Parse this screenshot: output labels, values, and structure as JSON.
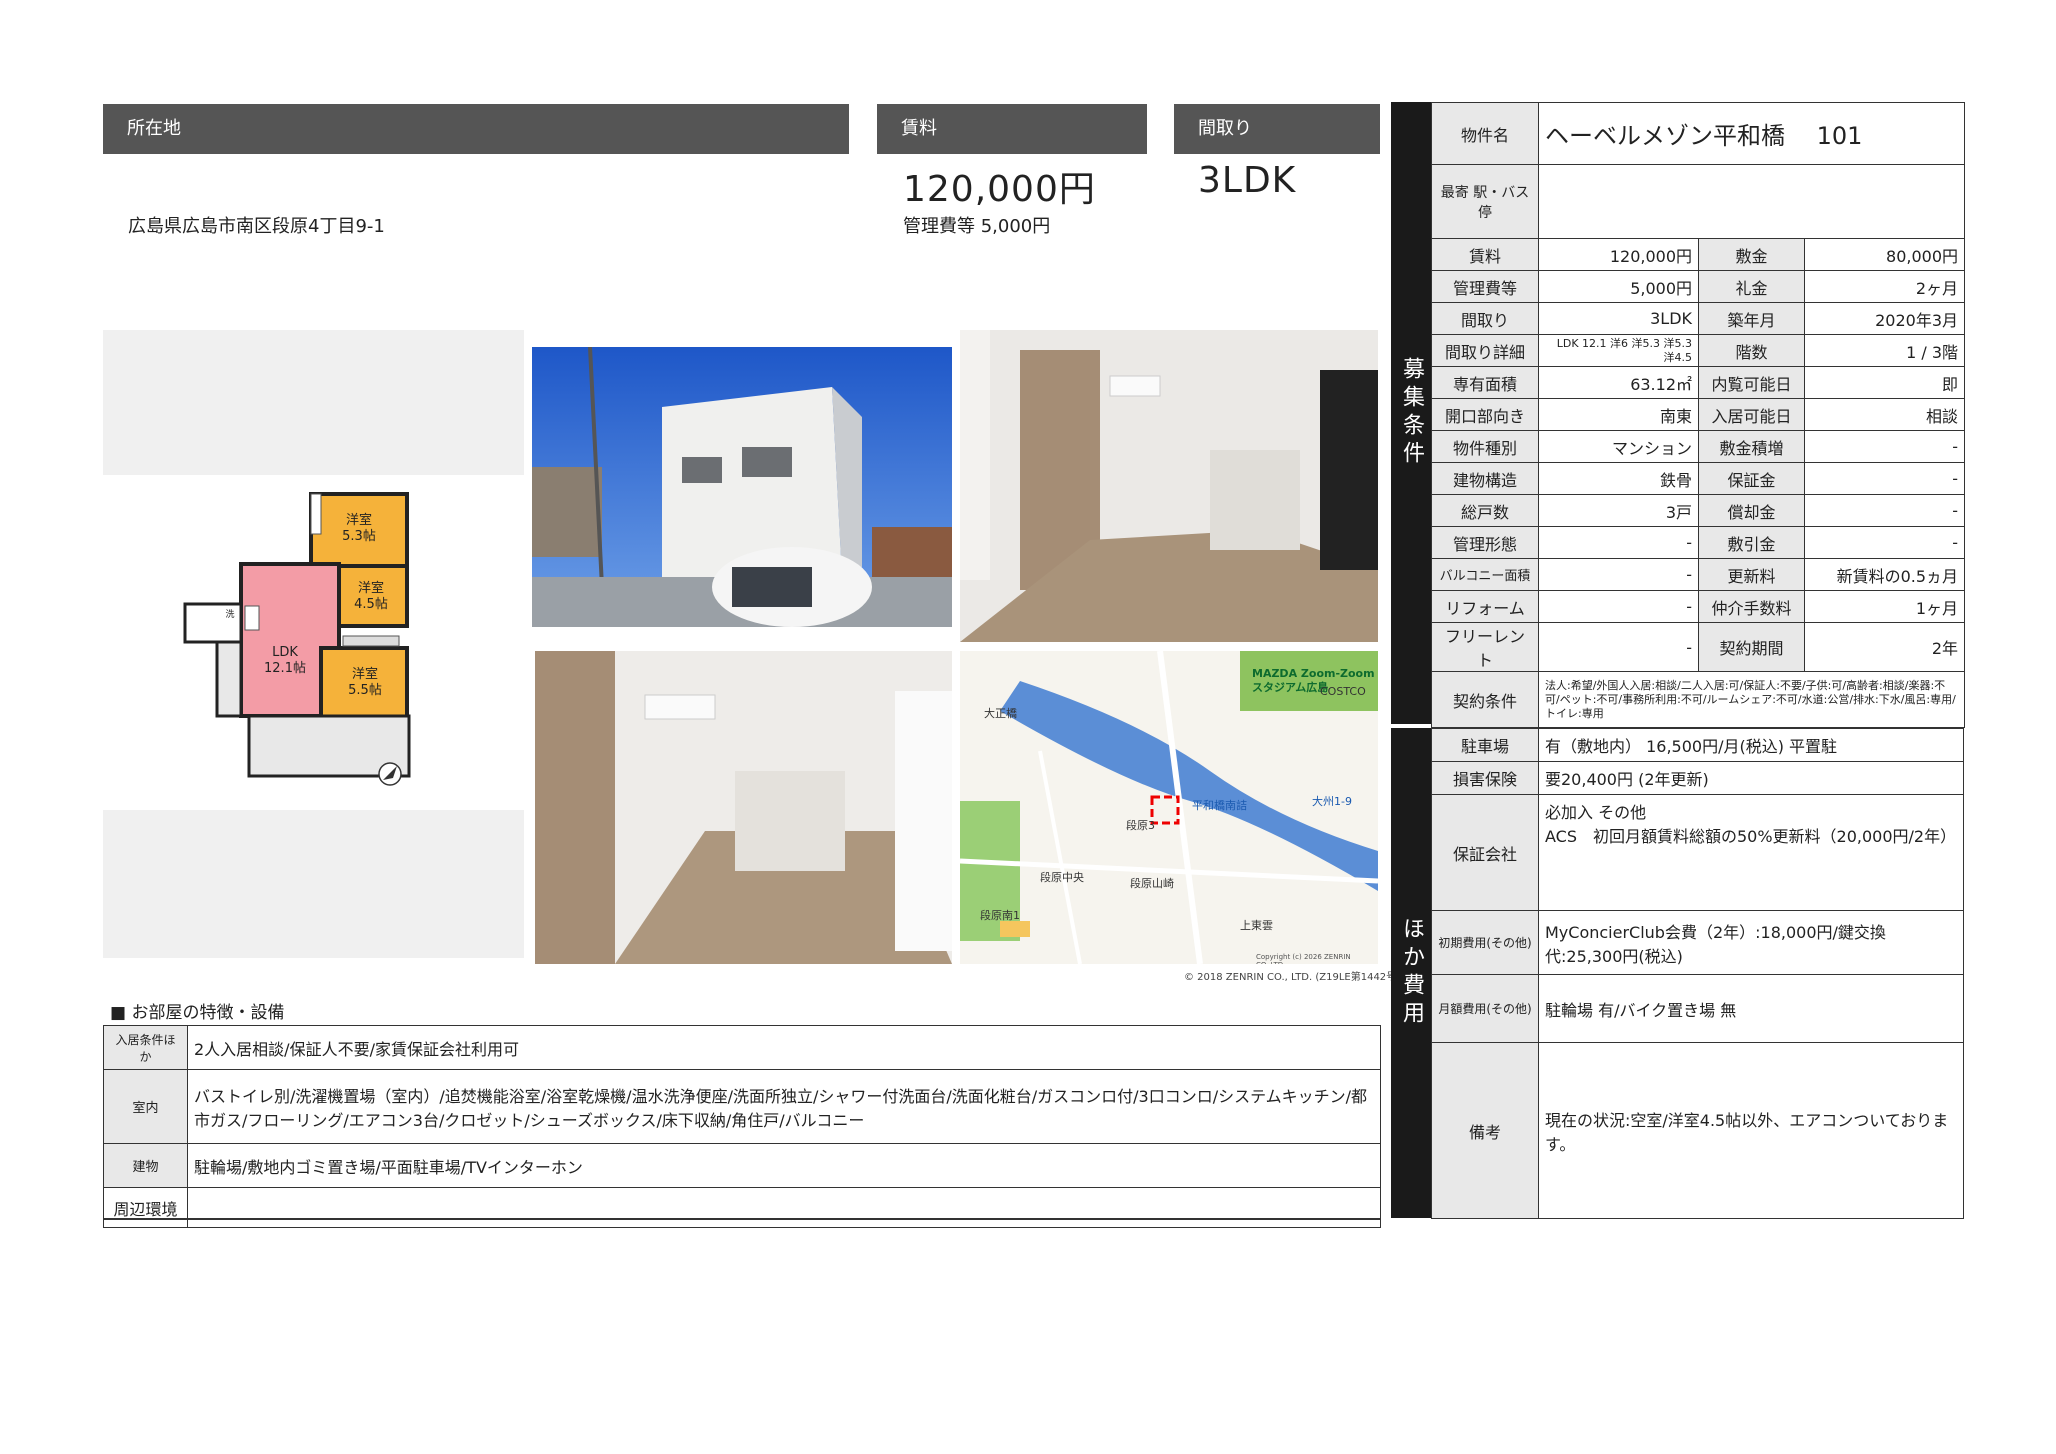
{
  "header": {
    "location_label": "所在地",
    "rent_label": "賃料",
    "layout_label": "間取り"
  },
  "summary": {
    "address": "広島県広島市南区段原4丁目9-1",
    "rent": "120,000円",
    "management_fee": "管理費等 5,000円",
    "layout": "3LDK"
  },
  "floorplan": {
    "rooms": [
      {
        "name": "洋室",
        "size": "5.3帖"
      },
      {
        "name": "洋室",
        "size": "4.5帖"
      },
      {
        "name": "LDK",
        "size": "12.1帖"
      },
      {
        "name": "洋室",
        "size": "5.5帖"
      }
    ],
    "wash_label": "洗"
  },
  "map": {
    "stadium": "MAZDA Zoom-Zoomスタジアム広島",
    "costco": "COSTCO",
    "labels": [
      "大正橋",
      "段原3",
      "段原南1",
      "平和橋南詰",
      "大州1-9",
      "段原中央",
      "段原山崎",
      "上東雲"
    ],
    "copyright_inner": "Copyright (c) 2026 ZENRIN CO.,LTD.",
    "copyright": "© 2018 ZENRIN CO., LTD. (Z19LE第1442号)"
  },
  "features": {
    "title": "■ お部屋の特徴・設備",
    "rows": [
      {
        "label": "入居条件ほか",
        "value": "2人入居相談/保証人不要/家賃保証会社利用可"
      },
      {
        "label": "室内",
        "value": "バストイレ別/洗濯機置場（室内）/追焚機能浴室/浴室乾燥機/温水洗浄便座/洗面所独立/シャワー付洗面台/洗面化粧台/ガスコンロ付/3口コンロ/システムキッチン/都市ガス/フローリング/エアコン3台/クロゼット/シューズボックス/床下収納/角住戸/バルコニー"
      },
      {
        "label": "建物",
        "value": "駐輪場/敷地内ゴミ置き場/平面駐車場/TVインターホン"
      },
      {
        "label": "周辺環境",
        "value": ""
      }
    ]
  },
  "conditions": {
    "side_label": "募集条件",
    "property_name_label": "物件名",
    "property_name": "ヘーベルメゾン平和橋　 101",
    "station_label": "最寄 駅・バス停",
    "station": "",
    "rows": [
      {
        "l1": "賃料",
        "v1": "120,000円",
        "l2": "敷金",
        "v2": "80,000円"
      },
      {
        "l1": "管理費等",
        "v1": "5,000円",
        "l2": "礼金",
        "v2": "2ヶ月"
      },
      {
        "l1": "間取り",
        "v1": "3LDK",
        "l2": "築年月",
        "v2": "2020年3月"
      },
      {
        "l1": "間取り詳細",
        "v1": "LDK 12.1 洋6 洋5.3 洋5.3 洋4.5",
        "l2": "階数",
        "v2": "1 / 3階"
      },
      {
        "l1": "専有面積",
        "v1": "63.12㎡",
        "l2": "内覧可能日",
        "v2": "即"
      },
      {
        "l1": "開口部向き",
        "v1": "南東",
        "l2": "入居可能日",
        "v2": "相談"
      },
      {
        "l1": "物件種別",
        "v1": "マンション",
        "l2": "敷金積増",
        "v2": "-"
      },
      {
        "l1": "建物構造",
        "v1": "鉄骨",
        "l2": "保証金",
        "v2": "-"
      },
      {
        "l1": "総戸数",
        "v1": "3戸",
        "l2": "償却金",
        "v2": "-"
      },
      {
        "l1": "管理形態",
        "v1": "-",
        "l2": "敷引金",
        "v2": "-"
      },
      {
        "l1": "バルコニー面積",
        "v1": "-",
        "l2": "更新料",
        "v2": "新賃料の0.5ヵ月"
      },
      {
        "l1": "リフォーム",
        "v1": "-",
        "l2": "仲介手数料",
        "v2": "1ヶ月"
      },
      {
        "l1": "フリーレント",
        "v1": "-",
        "l2": "契約期間",
        "v2": "2年"
      }
    ],
    "contract_label": "契約条件",
    "contract": "法人:希望/外国人入居:相談/二人入居:可/保証人:不要/子供:可/高齢者:相談/楽器:不可/ペット:不可/事務所利用:不可/ルームシェア:不可/水道:公営/排水:下水/風呂:専用/トイレ:専用"
  },
  "costs": {
    "side_label": "ほか費用",
    "rows": [
      {
        "label": "駐車場",
        "value": "有（敷地内） 16,500円/月(税込) 平置駐"
      },
      {
        "label": "損害保険",
        "value": "要20,400円 (2年更新)"
      },
      {
        "label": "保証会社",
        "value": "必加入 その他\nACS　初回月額賃料総額の50%更新料（20,000円/2年）"
      },
      {
        "label": "初期費用(その他)",
        "value": "MyConcierClub会費（2年）:18,000円/鍵交換代:25,300円(税込)"
      },
      {
        "label": "月額費用(その他)",
        "value": "駐輪場 有/バイク置き場 無"
      },
      {
        "label": "備考",
        "value": "現在の状況:空室/洋室4.5帖以外、エアコンついております。"
      }
    ]
  }
}
